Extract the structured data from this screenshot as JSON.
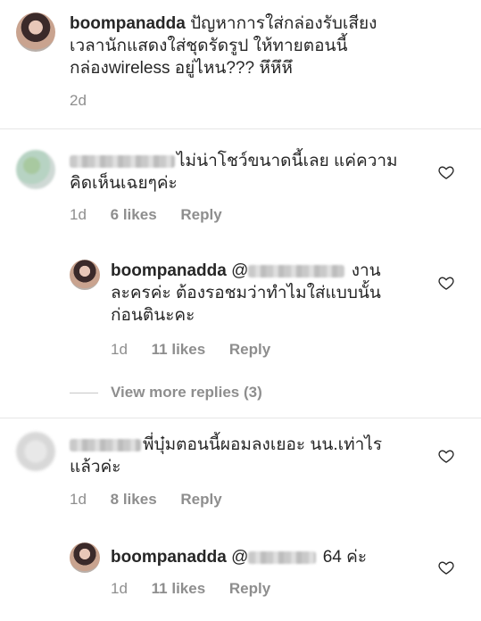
{
  "post_caption": {
    "username": "boompanadda",
    "text_line1": " ปัญหาการใส่กล่องรับเสียง",
    "text_line2": "เวลานักแสดงใส่ชุดรัดรูป ให้ทายตอนนี้",
    "text_line3": "กล่องwireless อยู่ไหน??? หึหึหึ",
    "time": "2d"
  },
  "comments": [
    {
      "text_line1": "ไม่น่าโชว์ขนาดนี้เลย แค่ความ",
      "text_line2": "คิดเห็นเฉยๆค่ะ",
      "time": "1d",
      "likes": "6 likes",
      "reply": "Reply"
    },
    {
      "username": "boompanadda",
      "mention": "@",
      "text_line1": " งาน",
      "text_line2": "ละครค่ะ ต้องรอชมว่าทำไมใส่แบบนั้น",
      "text_line3": "ก่อนตินะคะ",
      "time": "1d",
      "likes": "11 likes",
      "reply": "Reply"
    },
    {
      "text_line1": "พี่บุ๋มตอนนี้ผอมลงเยอะ นน.เท่าไร",
      "text_line2": "แล้วค่ะ",
      "time": "1d",
      "likes": "8 likes",
      "reply": "Reply"
    },
    {
      "username": "boompanadda",
      "mention": "@",
      "text_line1": " 64 ค่ะ",
      "time": "1d",
      "likes": "11 likes",
      "reply": "Reply"
    }
  ],
  "view_more": "View more replies (3)",
  "icons": {
    "heart": "heart-outline-icon"
  },
  "colors": {
    "meta_gray": "#8e8e8e",
    "text": "#262626"
  }
}
